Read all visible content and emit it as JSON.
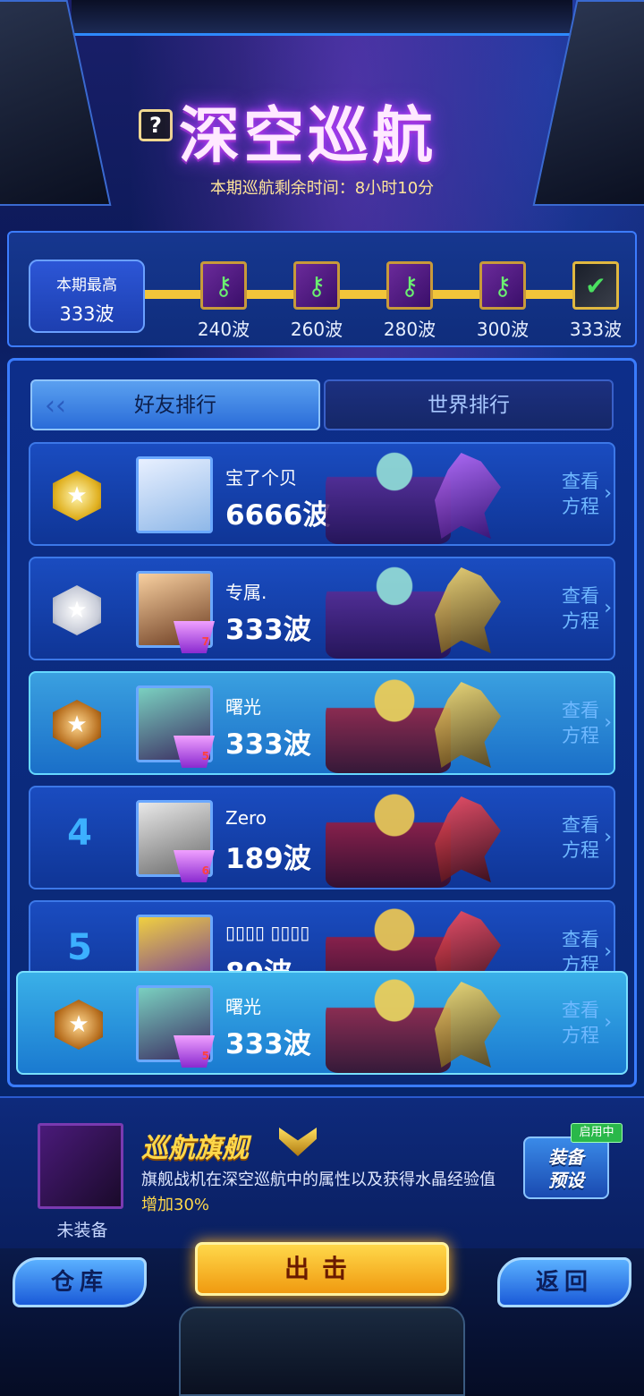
{
  "header": {
    "title": "深空巡航",
    "help_icon": "?",
    "subtitle": "本期巡航剩余时间：8小时10分"
  },
  "progress": {
    "best_label": "本期最高",
    "best_value": "333波",
    "milestones": [
      {
        "label": "240波",
        "claimed": false
      },
      {
        "label": "260波",
        "claimed": false
      },
      {
        "label": "280波",
        "claimed": false
      },
      {
        "label": "300波",
        "claimed": false
      },
      {
        "label": "333波",
        "claimed": true
      }
    ]
  },
  "tabs": {
    "friends": "好友排行",
    "world": "世界排行"
  },
  "view_label_1": "查看",
  "view_label_2": "方程",
  "rankings": [
    {
      "rank": "1",
      "name": "宝了个贝",
      "wave": "6666波"
    },
    {
      "rank": "2",
      "name": "专属.",
      "wave": "333波",
      "vip": "7"
    },
    {
      "rank": "3",
      "name": "曙光",
      "wave": "333波",
      "vip": "5"
    },
    {
      "rank": "4",
      "name": "Zero",
      "wave": "189波",
      "vip": "6"
    },
    {
      "rank": "5",
      "name": "▯▯▯▯ ▯▯▯▯",
      "wave": "89波"
    }
  ],
  "self": {
    "name": "曙光",
    "wave": "333波",
    "vip": "5"
  },
  "flagship": {
    "title": "巡航旗舰",
    "status": "未装备",
    "desc_main": "旗舰战机在深空巡航中的属性以及获得水晶经验值",
    "desc_highlight": "增加30%",
    "preset_line1": "装备",
    "preset_line2": "预设",
    "enabled_tag": "启用中"
  },
  "buttons": {
    "store": "仓库",
    "attack": "出击",
    "back": "返回"
  }
}
